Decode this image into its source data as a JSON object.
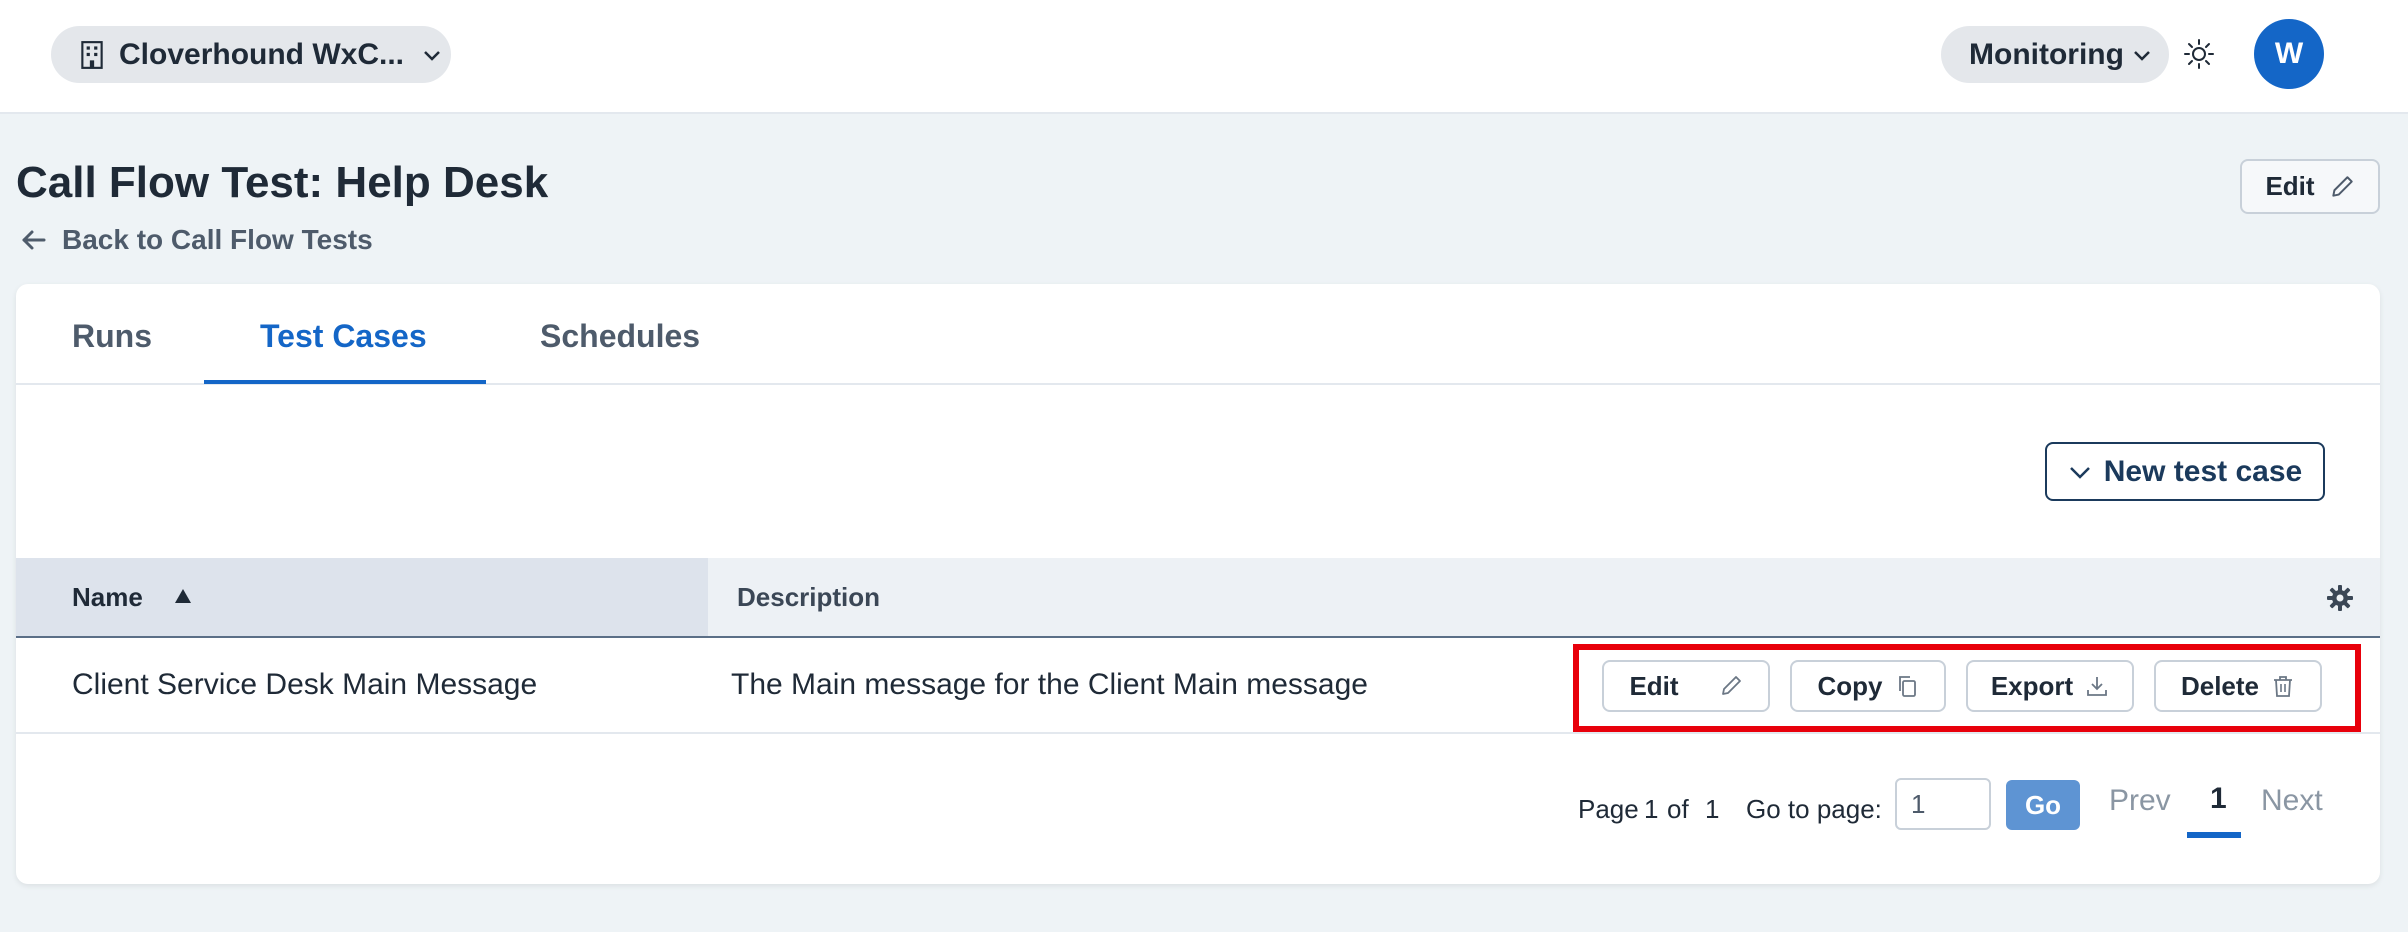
{
  "topbar": {
    "org_name": "Cloverhound WxC...",
    "monitoring_label": "Monitoring",
    "avatar_initial": "W"
  },
  "page": {
    "title": "Call Flow Test: Help Desk",
    "back_label": "Back to Call Flow Tests",
    "edit_label": "Edit"
  },
  "tabs": [
    {
      "label": "Runs",
      "active": false
    },
    {
      "label": "Test Cases",
      "active": true
    },
    {
      "label": "Schedules",
      "active": false
    }
  ],
  "toolbar": {
    "new_test_case_label": "New test case"
  },
  "table": {
    "columns": [
      "Name",
      "Description"
    ],
    "rows": [
      {
        "name": "Client Service Desk Main Message",
        "description": "The Main message for the Client Main message",
        "actions": [
          "Edit",
          "Copy",
          "Export",
          "Delete"
        ]
      }
    ]
  },
  "pagination": {
    "page_label": "Page",
    "current_page": "1",
    "of_label": "of",
    "total_pages": "1",
    "goto_label": "Go to page:",
    "goto_value": "1",
    "go_label": "Go",
    "prev_label": "Prev",
    "next_label": "Next"
  },
  "colors": {
    "accent": "#1466c7",
    "highlight": "#e8000b"
  }
}
